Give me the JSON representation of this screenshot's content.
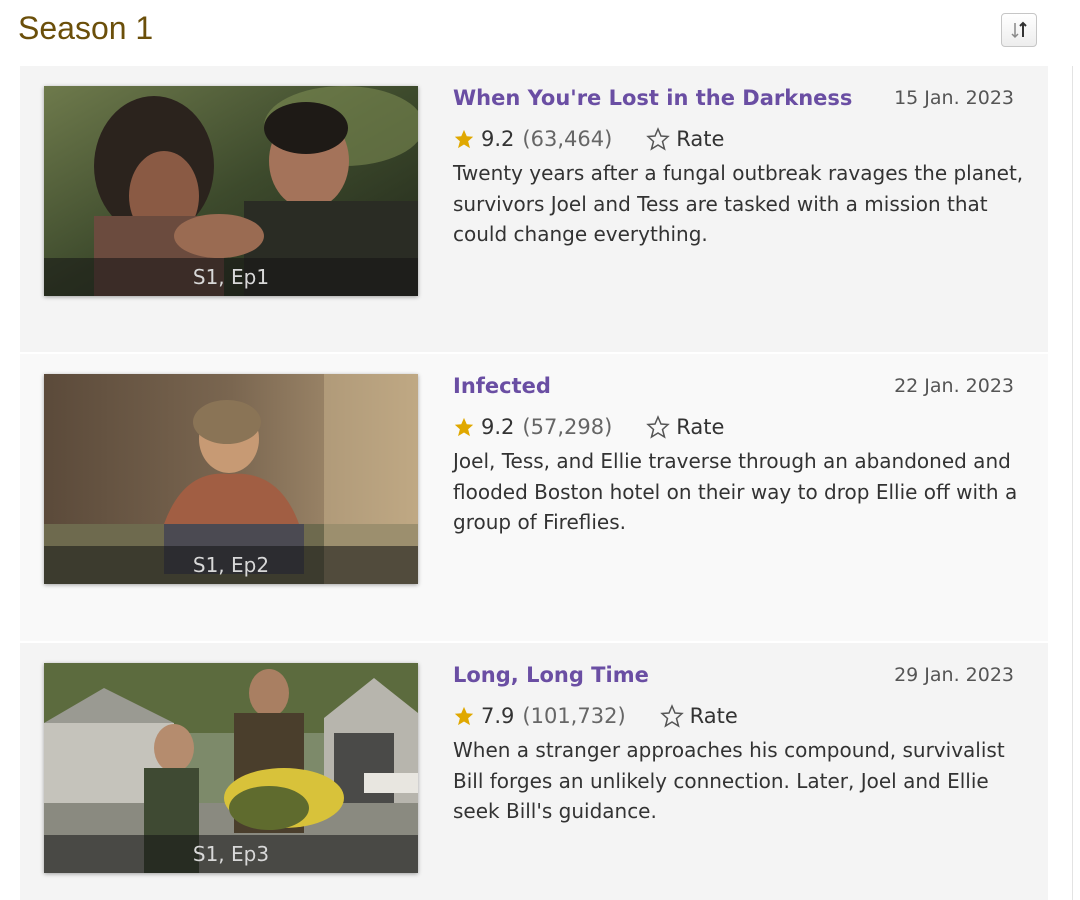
{
  "season": {
    "title": "Season 1",
    "sort_icon": "sort-toggle-icon"
  },
  "episodes": [
    {
      "label": "S1, Ep1",
      "title": "When You're Lost in the Darkness",
      "air_date": "15 Jan. 2023",
      "rating": "9.2",
      "votes": "(63,464)",
      "rate_label": "Rate",
      "description": "Twenty years after a fungal outbreak ravages the planet, survivors Joel and Tess are tasked with a mission that could change everything."
    },
    {
      "label": "S1, Ep2",
      "title": "Infected",
      "air_date": "22 Jan. 2023",
      "rating": "9.2",
      "votes": "(57,298)",
      "rate_label": "Rate",
      "description": "Joel, Tess, and Ellie traverse through an abandoned and flooded Boston hotel on their way to drop Ellie off with a group of Fireflies."
    },
    {
      "label": "S1, Ep3",
      "title": "Long, Long Time",
      "air_date": "29 Jan. 2023",
      "rating": "7.9",
      "votes": "(101,732)",
      "rate_label": "Rate",
      "description": "When a stranger approaches his compound, survivalist Bill forges an unlikely connection. Later, Joel and Ellie seek Bill's guidance."
    }
  ],
  "colors": {
    "season_title": "#6b4f0a",
    "episode_title": "#6a4ea3",
    "star_gold": "#e0a800"
  }
}
